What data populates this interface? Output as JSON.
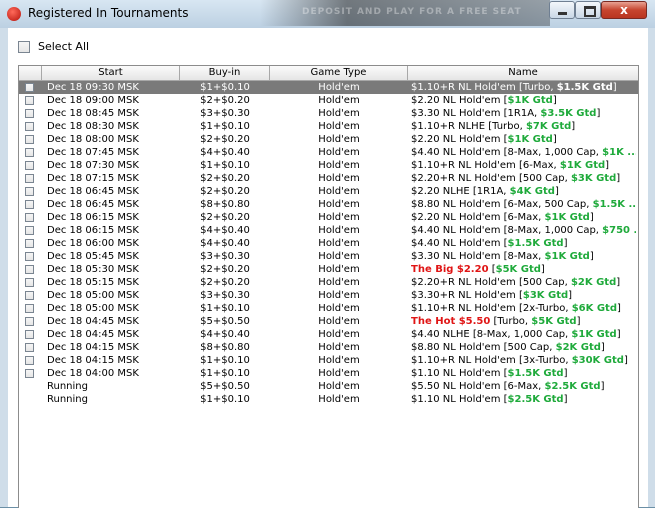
{
  "window": {
    "title": "Registered In Tournaments",
    "banner": "DEPOSIT AND PLAY FOR A FREE SEAT",
    "close_glyph": "x"
  },
  "select_all": {
    "label": "Select All"
  },
  "columns": {
    "start": "Start",
    "buyin": "Buy-in",
    "game_type": "Game Type",
    "name": "Name"
  },
  "rows": [
    {
      "start": "Dec 18  09:30 MSK",
      "buyin": "$1+$0.10",
      "type": "Hold'em",
      "name_hl": "",
      "name": "$1.10+R NL Hold'em [Turbo, ",
      "gtd": "$1.5K Gtd",
      "name_end": "]",
      "checkbox": true,
      "selected": true
    },
    {
      "start": "Dec 18  09:00 MSK",
      "buyin": "$2+$0.20",
      "type": "Hold'em",
      "name_hl": "",
      "name": "$2.20 NL Hold'em [",
      "gtd": "$1K Gtd",
      "name_end": "]",
      "checkbox": true
    },
    {
      "start": "Dec 18  08:45 MSK",
      "buyin": "$3+$0.30",
      "type": "Hold'em",
      "name_hl": "",
      "name": "$3.30 NL Hold'em [1R1A, ",
      "gtd": "$3.5K Gtd",
      "name_end": "]",
      "checkbox": true
    },
    {
      "start": "Dec 18  08:30 MSK",
      "buyin": "$1+$0.10",
      "type": "Hold'em",
      "name_hl": "",
      "name": "$1.10+R NLHE [Turbo, ",
      "gtd": "$7K Gtd",
      "name_end": "]",
      "checkbox": true
    },
    {
      "start": "Dec 18  08:00 MSK",
      "buyin": "$2+$0.20",
      "type": "Hold'em",
      "name_hl": "",
      "name": "$2.20 NL Hold'em [",
      "gtd": "$1K Gtd",
      "name_end": "]",
      "checkbox": true
    },
    {
      "start": "Dec 18  07:45 MSK",
      "buyin": "$4+$0.40",
      "type": "Hold'em",
      "name_hl": "",
      "name": "$4.40 NL Hold'em [8-Max, 1,000 Cap, ",
      "gtd": "$1K ...",
      "name_end": "",
      "checkbox": true
    },
    {
      "start": "Dec 18  07:30 MSK",
      "buyin": "$1+$0.10",
      "type": "Hold'em",
      "name_hl": "",
      "name": "$1.10+R NL Hold'em [6-Max, ",
      "gtd": "$1K Gtd",
      "name_end": "]",
      "checkbox": true
    },
    {
      "start": "Dec 18  07:15 MSK",
      "buyin": "$2+$0.20",
      "type": "Hold'em",
      "name_hl": "",
      "name": "$2.20+R NL Hold'em [500 Cap, ",
      "gtd": "$3K Gtd",
      "name_end": "]",
      "checkbox": true
    },
    {
      "start": "Dec 18  06:45 MSK",
      "buyin": "$2+$0.20",
      "type": "Hold'em",
      "name_hl": "",
      "name": "$2.20 NLHE [1R1A, ",
      "gtd": "$4K Gtd",
      "name_end": "]",
      "checkbox": true
    },
    {
      "start": "Dec 18  06:45 MSK",
      "buyin": "$8+$0.80",
      "type": "Hold'em",
      "name_hl": "",
      "name": "$8.80 NL Hold'em [6-Max, 500 Cap, ",
      "gtd": "$1.5K ...",
      "name_end": "",
      "checkbox": true
    },
    {
      "start": "Dec 18  06:15 MSK",
      "buyin": "$2+$0.20",
      "type": "Hold'em",
      "name_hl": "",
      "name": "$2.20 NL Hold'em [6-Max, ",
      "gtd": "$1K Gtd",
      "name_end": "]",
      "checkbox": true
    },
    {
      "start": "Dec 18  06:15 MSK",
      "buyin": "$4+$0.40",
      "type": "Hold'em",
      "name_hl": "",
      "name": "$4.40 NL Hold'em [8-Max, 1,000 Cap, ",
      "gtd": "$750 ...",
      "name_end": "",
      "checkbox": true
    },
    {
      "start": "Dec 18  06:00 MSK",
      "buyin": "$4+$0.40",
      "type": "Hold'em",
      "name_hl": "",
      "name": "$4.40 NL Hold'em [",
      "gtd": "$1.5K Gtd",
      "name_end": "]",
      "checkbox": true
    },
    {
      "start": "Dec 18  05:45 MSK",
      "buyin": "$3+$0.30",
      "type": "Hold'em",
      "name_hl": "",
      "name": "$3.30 NL Hold'em [8-Max, ",
      "gtd": "$1K Gtd",
      "name_end": "]",
      "checkbox": true
    },
    {
      "start": "Dec 18  05:30 MSK",
      "buyin": "$2+$0.20",
      "type": "Hold'em",
      "name_hl": "The Big $2.20",
      "name": " [",
      "gtd": "$5K Gtd",
      "name_end": "]",
      "checkbox": true
    },
    {
      "start": "Dec 18  05:15 MSK",
      "buyin": "$2+$0.20",
      "type": "Hold'em",
      "name_hl": "",
      "name": "$2.20+R NL Hold'em [500 Cap, ",
      "gtd": "$2K Gtd",
      "name_end": "]",
      "checkbox": true
    },
    {
      "start": "Dec 18  05:00 MSK",
      "buyin": "$3+$0.30",
      "type": "Hold'em",
      "name_hl": "",
      "name": "$3.30+R NL Hold'em [",
      "gtd": "$3K Gtd",
      "name_end": "]",
      "checkbox": true
    },
    {
      "start": "Dec 18  05:00 MSK",
      "buyin": "$1+$0.10",
      "type": "Hold'em",
      "name_hl": "",
      "name": "$1.10+R NL Hold'em [2x-Turbo, ",
      "gtd": "$6K Gtd",
      "name_end": "]",
      "checkbox": true
    },
    {
      "start": "Dec 18  04:45 MSK",
      "buyin": "$5+$0.50",
      "type": "Hold'em",
      "name_hl": "The Hot $5.50",
      "name": " [Turbo, ",
      "gtd": "$5K Gtd",
      "name_end": "]",
      "checkbox": true
    },
    {
      "start": "Dec 18  04:45 MSK",
      "buyin": "$4+$0.40",
      "type": "Hold'em",
      "name_hl": "",
      "name": "$4.40 NLHE [8-Max, 1,000 Cap, ",
      "gtd": "$1K Gtd",
      "name_end": "]",
      "checkbox": true
    },
    {
      "start": "Dec 18  04:15 MSK",
      "buyin": "$8+$0.80",
      "type": "Hold'em",
      "name_hl": "",
      "name": "$8.80 NL Hold'em [500 Cap, ",
      "gtd": "$2K Gtd",
      "name_end": "]",
      "checkbox": true
    },
    {
      "start": "Dec 18  04:15 MSK",
      "buyin": "$1+$0.10",
      "type": "Hold'em",
      "name_hl": "",
      "name": "$1.10+R NL Hold'em [3x-Turbo, ",
      "gtd": "$30K Gtd",
      "name_end": "]",
      "checkbox": true
    },
    {
      "start": "Dec 18  04:00 MSK",
      "buyin": "$1+$0.10",
      "type": "Hold'em",
      "name_hl": "",
      "name": "$1.10 NL Hold'em [",
      "gtd": "$1.5K Gtd",
      "name_end": "]",
      "checkbox": true
    },
    {
      "start": "Running",
      "buyin": "$5+$0.50",
      "type": "Hold'em",
      "name_hl": "",
      "name": "$5.50 NL Hold'em [6-Max, ",
      "gtd": "$2.5K Gtd",
      "name_end": "]",
      "checkbox": false
    },
    {
      "start": "Running",
      "buyin": "$1+$0.10",
      "type": "Hold'em",
      "name_hl": "",
      "name": "$1.10 NL Hold'em [",
      "gtd": "$2.5K Gtd",
      "name_end": "]",
      "checkbox": false
    }
  ],
  "colors": {
    "gtd_green": "#1faa3b",
    "highlight_red": "#e01515",
    "selected_row": "#7a7a7a"
  }
}
